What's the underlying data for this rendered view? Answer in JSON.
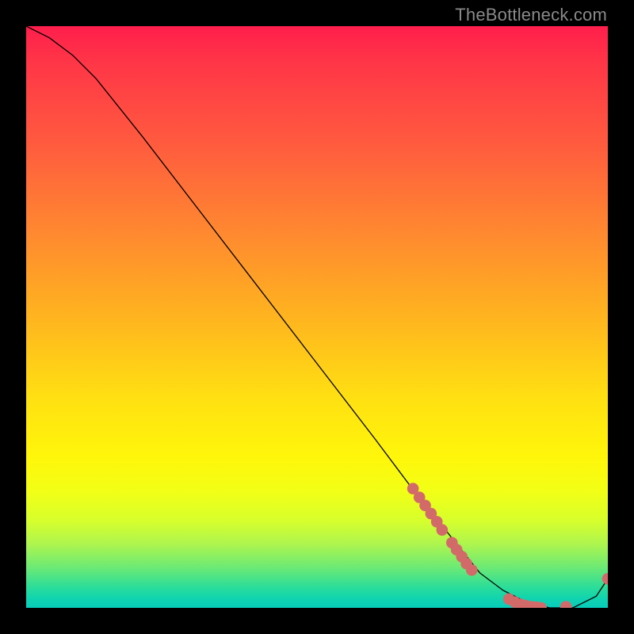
{
  "watermark": "TheBottleneck.com",
  "chart_data": {
    "type": "line",
    "title": "",
    "xlabel": "",
    "ylabel": "",
    "xlim": [
      0,
      100
    ],
    "ylim": [
      0,
      100
    ],
    "grid": false,
    "legend": false,
    "series": [
      {
        "name": "curve",
        "color": "#000000",
        "x": [
          0,
          4,
          8,
          12,
          20,
          30,
          40,
          50,
          60,
          66,
          70,
          74,
          78,
          82,
          86,
          90,
          94,
          98,
          100
        ],
        "y": [
          100,
          98,
          95,
          91,
          81,
          68,
          55,
          42,
          29,
          21,
          16,
          11,
          6,
          3,
          1,
          0,
          0,
          2,
          5
        ]
      }
    ],
    "markers": [
      {
        "x": 66.5,
        "y": 20.5,
        "r": 1.0,
        "color": "#d36a6a"
      },
      {
        "x": 67.6,
        "y": 19.0,
        "r": 1.0,
        "color": "#d36a6a"
      },
      {
        "x": 68.6,
        "y": 17.6,
        "r": 1.0,
        "color": "#d36a6a"
      },
      {
        "x": 69.6,
        "y": 16.2,
        "r": 1.0,
        "color": "#d36a6a"
      },
      {
        "x": 70.6,
        "y": 14.8,
        "r": 1.0,
        "color": "#d36a6a"
      },
      {
        "x": 71.5,
        "y": 13.4,
        "r": 1.0,
        "color": "#d36a6a"
      },
      {
        "x": 73.2,
        "y": 11.2,
        "r": 1.0,
        "color": "#d36a6a"
      },
      {
        "x": 74.0,
        "y": 10.0,
        "r": 1.0,
        "color": "#d36a6a"
      },
      {
        "x": 74.9,
        "y": 8.8,
        "r": 1.0,
        "color": "#d36a6a"
      },
      {
        "x": 75.7,
        "y": 7.6,
        "r": 1.0,
        "color": "#d36a6a"
      },
      {
        "x": 76.6,
        "y": 6.5,
        "r": 1.0,
        "color": "#d36a6a"
      },
      {
        "x": 83.0,
        "y": 1.5,
        "r": 1.0,
        "color": "#d36a6a"
      },
      {
        "x": 84.0,
        "y": 1.0,
        "r": 1.0,
        "color": "#d36a6a"
      },
      {
        "x": 85.0,
        "y": 0.6,
        "r": 1.0,
        "color": "#d36a6a"
      },
      {
        "x": 85.8,
        "y": 0.4,
        "r": 1.0,
        "color": "#d36a6a"
      },
      {
        "x": 86.8,
        "y": 0.2,
        "r": 1.0,
        "color": "#d36a6a"
      },
      {
        "x": 87.7,
        "y": 0.1,
        "r": 1.0,
        "color": "#d36a6a"
      },
      {
        "x": 88.5,
        "y": 0.0,
        "r": 1.0,
        "color": "#d36a6a"
      },
      {
        "x": 92.8,
        "y": 0.2,
        "r": 1.0,
        "color": "#d36a6a"
      },
      {
        "x": 100.0,
        "y": 5.0,
        "r": 1.0,
        "color": "#d36a6a"
      }
    ]
  }
}
